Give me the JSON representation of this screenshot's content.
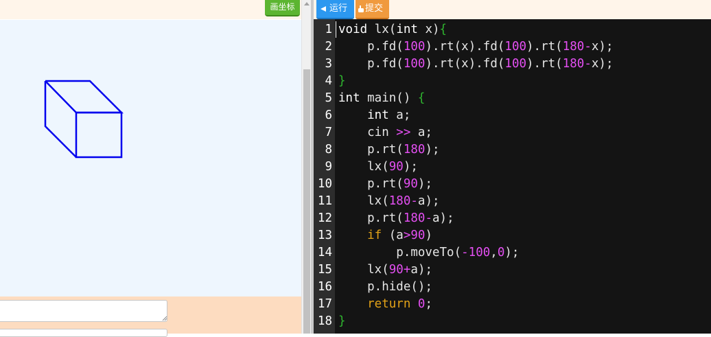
{
  "left_panel": {
    "draw_axes_label": "画坐标",
    "input_placeholder": "",
    "input_value": ""
  },
  "toolbar": {
    "run_label": "运行",
    "submit_label": "提交"
  },
  "editor": {
    "line_numbers": [
      "1",
      "2",
      "3",
      "4",
      "5",
      "6",
      "7",
      "8",
      "9",
      "10",
      "11",
      "12",
      "13",
      "14",
      "15",
      "16",
      "17",
      "18"
    ],
    "lines": [
      [
        [
          "kw",
          "void"
        ],
        [
          "id",
          " lx"
        ],
        [
          "punc",
          "("
        ],
        [
          "kw",
          "int"
        ],
        [
          "id",
          " x"
        ],
        [
          "punc",
          ")"
        ],
        [
          "brace",
          "{"
        ]
      ],
      [
        [
          "id",
          "    p."
        ],
        [
          "fn",
          "fd"
        ],
        [
          "punc",
          "("
        ],
        [
          "num",
          "100"
        ],
        [
          "punc",
          ")."
        ],
        [
          "fn",
          "rt"
        ],
        [
          "punc",
          "("
        ],
        [
          "id",
          "x"
        ],
        [
          "punc",
          ")."
        ],
        [
          "fn",
          "fd"
        ],
        [
          "punc",
          "("
        ],
        [
          "num",
          "100"
        ],
        [
          "punc",
          ")."
        ],
        [
          "fn",
          "rt"
        ],
        [
          "punc",
          "("
        ],
        [
          "num",
          "180"
        ],
        [
          "op",
          "-"
        ],
        [
          "id",
          "x"
        ],
        [
          "punc",
          ");"
        ]
      ],
      [
        [
          "id",
          "    p."
        ],
        [
          "fn",
          "fd"
        ],
        [
          "punc",
          "("
        ],
        [
          "num",
          "100"
        ],
        [
          "punc",
          ")."
        ],
        [
          "fn",
          "rt"
        ],
        [
          "punc",
          "("
        ],
        [
          "id",
          "x"
        ],
        [
          "punc",
          ")."
        ],
        [
          "fn",
          "fd"
        ],
        [
          "punc",
          "("
        ],
        [
          "num",
          "100"
        ],
        [
          "punc",
          ")."
        ],
        [
          "fn",
          "rt"
        ],
        [
          "punc",
          "("
        ],
        [
          "num",
          "180"
        ],
        [
          "op",
          "-"
        ],
        [
          "id",
          "x"
        ],
        [
          "punc",
          ");"
        ]
      ],
      [
        [
          "brace",
          "}"
        ]
      ],
      [
        [
          "kw",
          "int"
        ],
        [
          "id",
          " main"
        ],
        [
          "punc",
          "() "
        ],
        [
          "brace",
          "{"
        ]
      ],
      [
        [
          "kw",
          "    int"
        ],
        [
          "id",
          " a"
        ],
        [
          "punc",
          ";"
        ]
      ],
      [
        [
          "id",
          "    cin "
        ],
        [
          "op",
          ">>"
        ],
        [
          "id",
          " a"
        ],
        [
          "punc",
          ";"
        ]
      ],
      [
        [
          "id",
          "    p."
        ],
        [
          "fn",
          "rt"
        ],
        [
          "punc",
          "("
        ],
        [
          "num",
          "180"
        ],
        [
          "punc",
          ");"
        ]
      ],
      [
        [
          "id",
          "    lx"
        ],
        [
          "punc",
          "("
        ],
        [
          "num",
          "90"
        ],
        [
          "punc",
          ");"
        ]
      ],
      [
        [
          "id",
          "    p."
        ],
        [
          "fn",
          "rt"
        ],
        [
          "punc",
          "("
        ],
        [
          "num",
          "90"
        ],
        [
          "punc",
          ");"
        ]
      ],
      [
        [
          "id",
          "    lx"
        ],
        [
          "punc",
          "("
        ],
        [
          "num",
          "180"
        ],
        [
          "op",
          "-"
        ],
        [
          "id",
          "a"
        ],
        [
          "punc",
          ");"
        ]
      ],
      [
        [
          "id",
          "    p."
        ],
        [
          "fn",
          "rt"
        ],
        [
          "punc",
          "("
        ],
        [
          "num",
          "180"
        ],
        [
          "op",
          "-"
        ],
        [
          "id",
          "a"
        ],
        [
          "punc",
          ");"
        ]
      ],
      [
        [
          "ctl",
          "    if"
        ],
        [
          "punc",
          " ("
        ],
        [
          "id",
          "a"
        ],
        [
          "op",
          ">"
        ],
        [
          "num",
          "90"
        ],
        [
          "punc",
          ")"
        ]
      ],
      [
        [
          "id",
          "        p."
        ],
        [
          "fn",
          "moveTo"
        ],
        [
          "punc",
          "("
        ],
        [
          "op",
          "-"
        ],
        [
          "num",
          "100"
        ],
        [
          "punc",
          ","
        ],
        [
          "num",
          "0"
        ],
        [
          "punc",
          ");"
        ]
      ],
      [
        [
          "id",
          "    lx"
        ],
        [
          "punc",
          "("
        ],
        [
          "num",
          "90"
        ],
        [
          "op",
          "+"
        ],
        [
          "id",
          "a"
        ],
        [
          "punc",
          ");"
        ]
      ],
      [
        [
          "id",
          "    p."
        ],
        [
          "fn",
          "hide"
        ],
        [
          "punc",
          "();"
        ]
      ],
      [
        [
          "ctl",
          "    return"
        ],
        [
          "num",
          " 0"
        ],
        [
          "punc",
          ";"
        ]
      ],
      [
        [
          "brace",
          "}"
        ]
      ]
    ]
  },
  "colors": {
    "drawing_stroke": "#0000ee",
    "canvas_bg": "#eef6fe",
    "editor_bg": "#141414",
    "run_button": "#2c98f0",
    "submit_button": "#f09a3e",
    "draw_axes_button": "#5cb531"
  },
  "icons": {
    "run": "play-left-arrow-icon",
    "submit": "hand-pointer-icon",
    "scroll_up": "chevron-up-icon"
  }
}
